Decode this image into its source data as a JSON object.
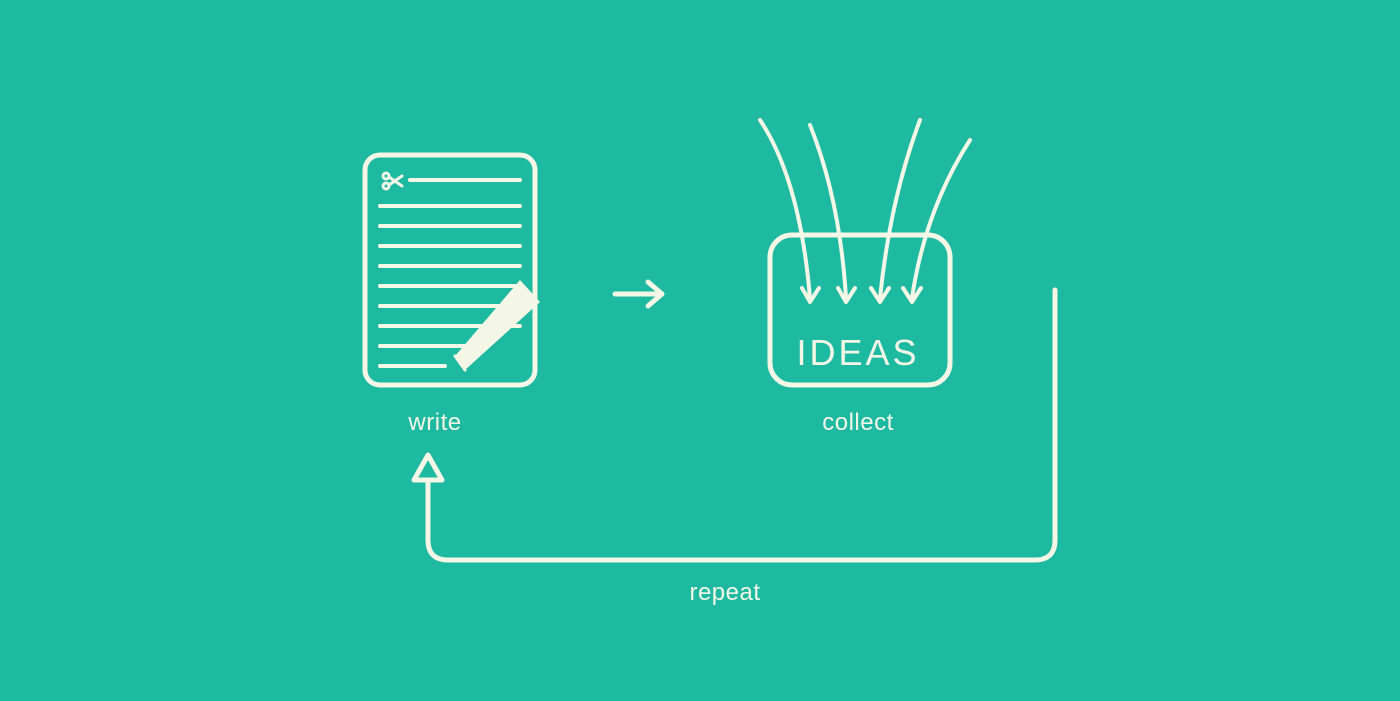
{
  "colors": {
    "background": "#1db9a0",
    "stroke": "#f4f6e6"
  },
  "nodes": {
    "write": {
      "label": "write"
    },
    "collect": {
      "label": "collect",
      "box_text": "IDEAS"
    },
    "repeat": {
      "label": "repeat"
    }
  },
  "flow": [
    "write",
    "collect",
    "repeat"
  ]
}
